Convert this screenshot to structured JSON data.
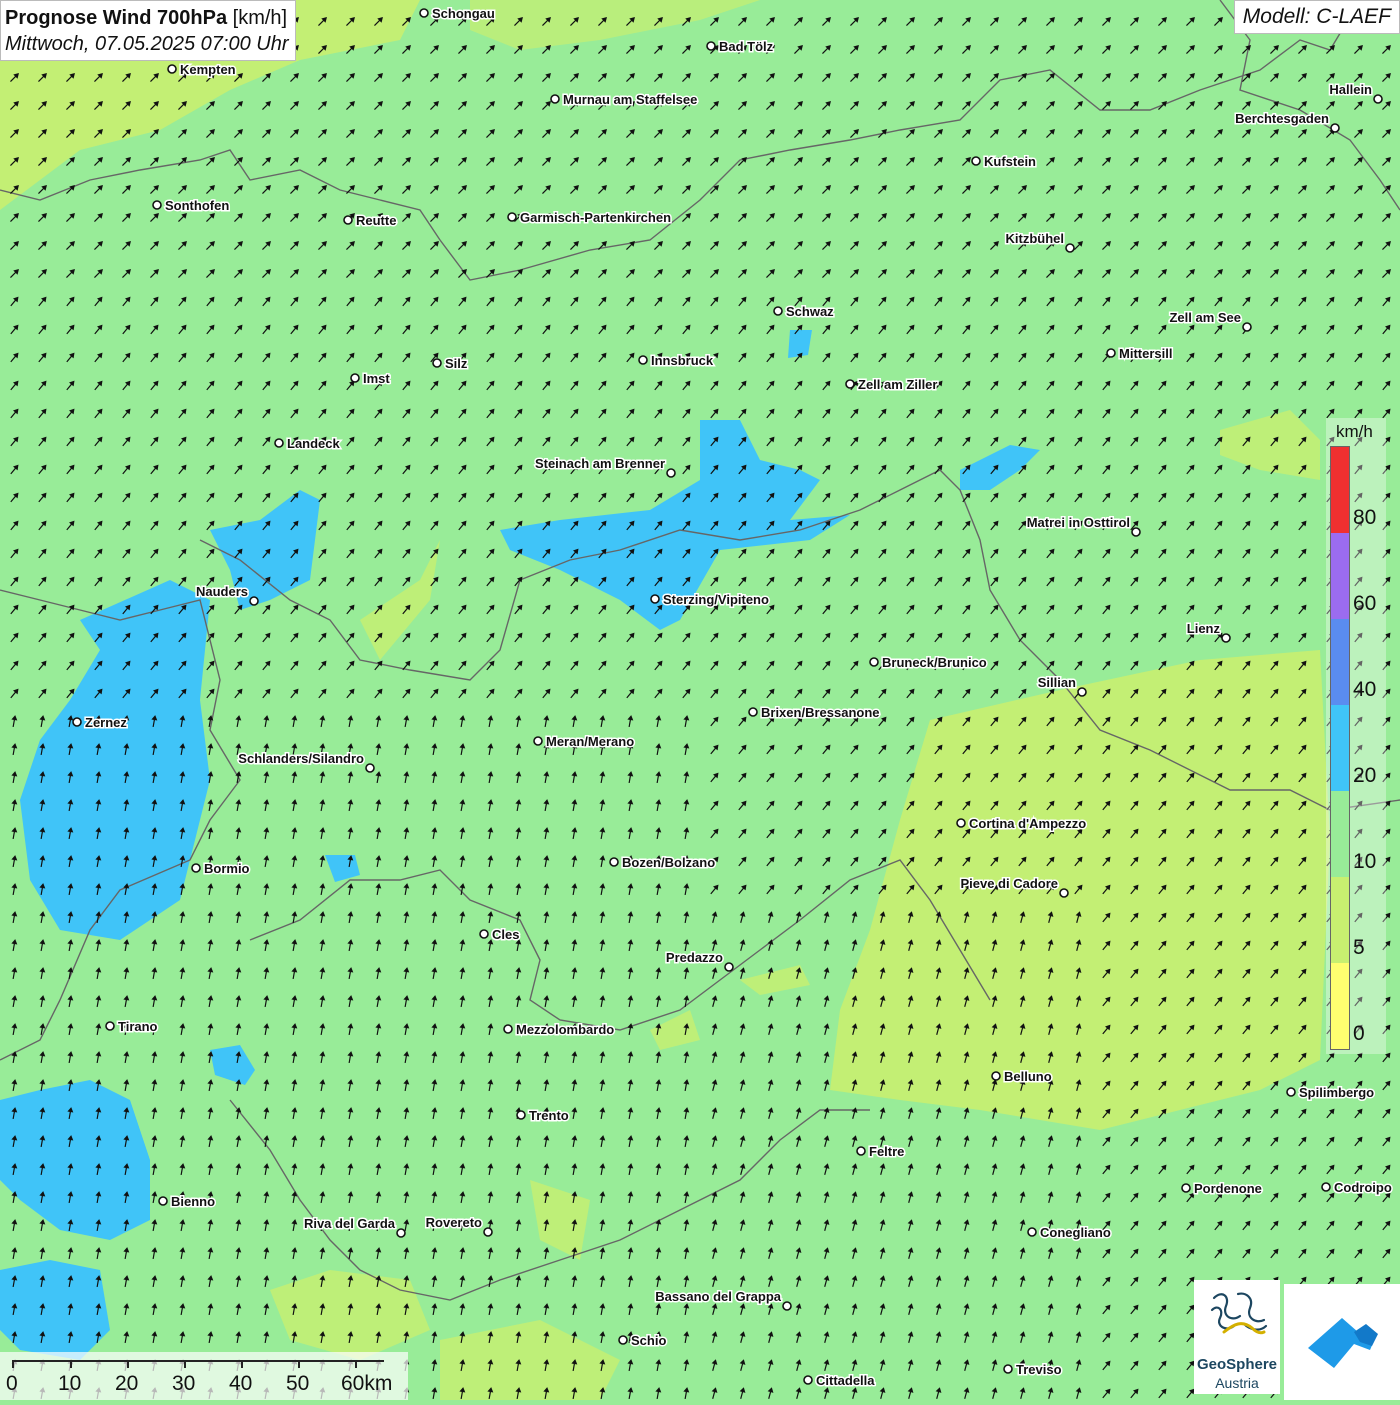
{
  "title": "Prognose Wind 700hPa",
  "unit": "[km/h]",
  "datetime": "Mittwoch, 07.05.2025 07:00 Uhr",
  "model": "Modell: C-LAEF",
  "legend": {
    "unit": "km/h",
    "ticks": [
      "80",
      "60",
      "40",
      "20",
      "10",
      "5",
      "0"
    ],
    "colors": [
      "#f03030",
      "#9b6cf0",
      "#5a8cf0",
      "#40c4f8",
      "#98ec98",
      "#c8f070",
      "#ffff70"
    ]
  },
  "scalebar": {
    "labels": [
      "0",
      "10",
      "20",
      "30",
      "40",
      "50",
      "60km"
    ]
  },
  "logo": {
    "name": "GeoSphere",
    "country": "Austria"
  },
  "wind_direction": "from south-west (arrows pointing north-east)",
  "cities": [
    {
      "name": "Schongau"
    },
    {
      "name": "Bad Tölz"
    },
    {
      "name": "Kempten"
    },
    {
      "name": "Murnau am Staffelsee"
    },
    {
      "name": "Hallein"
    },
    {
      "name": "Berchtesgaden"
    },
    {
      "name": "Kufstein"
    },
    {
      "name": "Sonthofen"
    },
    {
      "name": "Reutte"
    },
    {
      "name": "Garmisch-Partenkirchen"
    },
    {
      "name": "Kitzbühel"
    },
    {
      "name": "Schwaz"
    },
    {
      "name": "Zell am See"
    },
    {
      "name": "Mittersill"
    },
    {
      "name": "Innsbruck"
    },
    {
      "name": "Silz"
    },
    {
      "name": "Imst"
    },
    {
      "name": "Zell am Ziller"
    },
    {
      "name": "Landeck"
    },
    {
      "name": "Steinach am Brenner"
    },
    {
      "name": "Matrei in Osttirol"
    },
    {
      "name": "Nauders"
    },
    {
      "name": "Sterzing/Vipiteno"
    },
    {
      "name": "Lienz"
    },
    {
      "name": "Bruneck/Brunico"
    },
    {
      "name": "Sillian"
    },
    {
      "name": "Brixen/Bressanone"
    },
    {
      "name": "Zernez"
    },
    {
      "name": "Meran/Merano"
    },
    {
      "name": "Schlanders/Silandro"
    },
    {
      "name": "Cortina d'Ampezzo"
    },
    {
      "name": "Bormio"
    },
    {
      "name": "Bozen/Bolzano"
    },
    {
      "name": "Pieve di Cadore"
    },
    {
      "name": "Cles"
    },
    {
      "name": "Predazzo"
    },
    {
      "name": "Tirano"
    },
    {
      "name": "Mezzolombardo"
    },
    {
      "name": "Belluno"
    },
    {
      "name": "Spilimbergo"
    },
    {
      "name": "Trento"
    },
    {
      "name": "Feltre"
    },
    {
      "name": "Bienno"
    },
    {
      "name": "Pordenone"
    },
    {
      "name": "Codroipo"
    },
    {
      "name": "Riva del Garda"
    },
    {
      "name": "Rovereto"
    },
    {
      "name": "Conegliano"
    },
    {
      "name": "Bassano del Grappa"
    },
    {
      "name": "Schio"
    },
    {
      "name": "Treviso"
    },
    {
      "name": "Cittadella"
    }
  ]
}
